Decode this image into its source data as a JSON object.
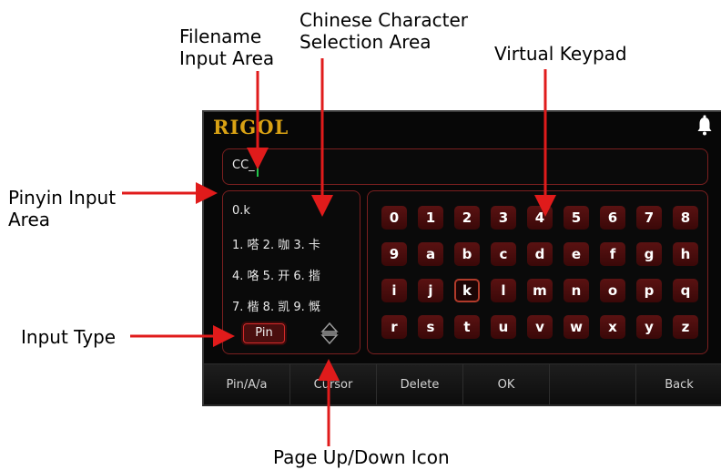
{
  "callouts": {
    "filename": "Filename\nInput Area",
    "chinese": "Chinese Character\nSelection Area",
    "keypad": "Virtual Keypad",
    "pinyin": "Pinyin Input\nArea",
    "input_type": "Input Type",
    "page": "Page Up/Down Icon"
  },
  "header": {
    "logo": "RIGOL",
    "icon": "bell-icon"
  },
  "filename": {
    "value": "CC_"
  },
  "pinyin": {
    "input": "0.k",
    "candidates": [
      "1. 嗒 2. 咖 3. 卡",
      "4. 咯 5. 开 6. 揩",
      "7. 楷 8. 凯 9. 慨"
    ],
    "type_button": "Pin"
  },
  "keypad": {
    "rows": [
      [
        "0",
        "1",
        "2",
        "3",
        "4",
        "5",
        "6",
        "7",
        "8"
      ],
      [
        "9",
        "a",
        "b",
        "c",
        "d",
        "e",
        "f",
        "g",
        "h"
      ],
      [
        "i",
        "j",
        "k",
        "l",
        "m",
        "n",
        "o",
        "p",
        "q"
      ],
      [
        "r",
        "s",
        "t",
        "u",
        "v",
        "w",
        "x",
        "y",
        "z"
      ]
    ],
    "selected": "k"
  },
  "softkeys": [
    "Pin/A/a",
    "Cursor",
    "Delete",
    "OK",
    "",
    "Back"
  ],
  "colors": {
    "accent_red": "#e01b1b",
    "logo_gold": "#d9a214",
    "cursor_green": "#22c64a"
  }
}
